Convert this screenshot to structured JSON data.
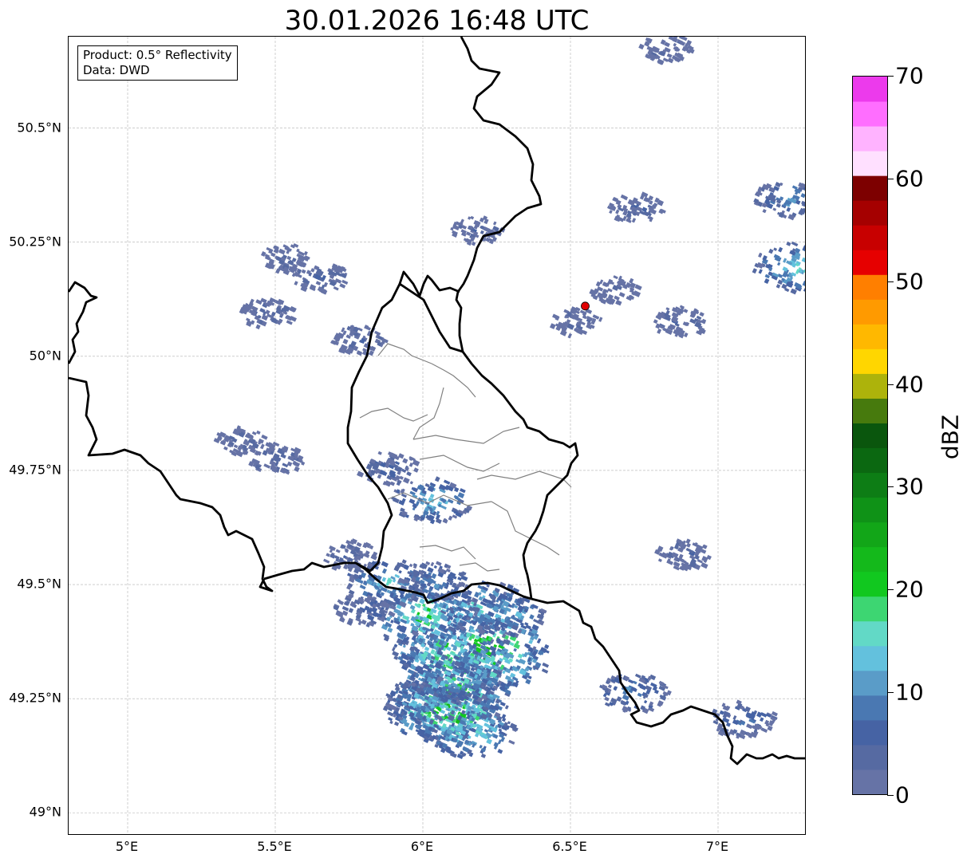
{
  "title": "30.01.2026 16:48 UTC",
  "info": {
    "product": "Product: 0.5° Reflectivity",
    "data": "Data: DWD"
  },
  "axes": {
    "lon_range": [
      4.8,
      7.3
    ],
    "lat_range": [
      48.95,
      50.7
    ],
    "x_ticks": [
      {
        "value": 5.0,
        "label": "5°E"
      },
      {
        "value": 5.5,
        "label": "5.5°E"
      },
      {
        "value": 6.0,
        "label": "6°E"
      },
      {
        "value": 6.5,
        "label": "6.5°E"
      },
      {
        "value": 7.0,
        "label": "7°E"
      }
    ],
    "y_ticks": [
      {
        "value": 49.0,
        "label": "49°N"
      },
      {
        "value": 49.25,
        "label": "49.25°N"
      },
      {
        "value": 49.5,
        "label": "49.5°N"
      },
      {
        "value": 49.75,
        "label": "49.75°N"
      },
      {
        "value": 50.0,
        "label": "50°N"
      },
      {
        "value": 50.25,
        "label": "50.25°N"
      },
      {
        "value": 50.5,
        "label": "50.5°N"
      }
    ],
    "grid": true
  },
  "radar_site": {
    "lon": 6.55,
    "lat": 50.11,
    "color": "#e00000"
  },
  "colorbar": {
    "label": "dBZ",
    "min": 0,
    "max": 70,
    "ticks": [
      {
        "value": 0,
        "label": "0"
      },
      {
        "value": 10,
        "label": "10"
      },
      {
        "value": 20,
        "label": "20"
      },
      {
        "value": 30,
        "label": "30"
      },
      {
        "value": 40,
        "label": "40"
      },
      {
        "value": 50,
        "label": "50"
      },
      {
        "value": 60,
        "label": "60"
      },
      {
        "value": 70,
        "label": "70"
      }
    ],
    "colors": [
      "#6673a6",
      "#566aa2",
      "#4663a4",
      "#4a78b2",
      "#5a9cc8",
      "#63c1dd",
      "#62d9c6",
      "#3dd672",
      "#11c81f",
      "#14b91b",
      "#12a618",
      "#0f9217",
      "#0d7d15",
      "#0b6811",
      "#0a560d",
      "#477a0d",
      "#adb30b",
      "#ffd600",
      "#ffb800",
      "#ff9a00",
      "#ff7f00",
      "#e60000",
      "#c80000",
      "#a50000",
      "#7d0000",
      "#ffe0ff",
      "#ffb3ff",
      "#ff6eff",
      "#ec3aec"
    ]
  },
  "chart_data": {
    "type": "map",
    "title": "30.01.2026 16:48 UTC",
    "xlim": [
      4.8,
      7.3
    ],
    "ylim": [
      48.95,
      50.7
    ],
    "units": "dBZ",
    "cells": [
      {
        "lon": 6.07,
        "lat": 49.24,
        "dbz": 25
      },
      {
        "lon": 6.1,
        "lat": 49.27,
        "dbz": 25
      },
      {
        "lon": 6.05,
        "lat": 49.22,
        "dbz": 22
      },
      {
        "lon": 6.13,
        "lat": 49.21,
        "dbz": 22
      },
      {
        "lon": 6.16,
        "lat": 49.18,
        "dbz": 18
      },
      {
        "lon": 6.0,
        "lat": 49.25,
        "dbz": 15
      },
      {
        "lon": 6.09,
        "lat": 49.33,
        "dbz": 22
      },
      {
        "lon": 6.07,
        "lat": 49.36,
        "dbz": 22
      },
      {
        "lon": 6.11,
        "lat": 49.3,
        "dbz": 18
      },
      {
        "lon": 6.23,
        "lat": 49.37,
        "dbz": 25
      },
      {
        "lon": 6.25,
        "lat": 49.33,
        "dbz": 20
      },
      {
        "lon": 5.99,
        "lat": 49.43,
        "dbz": 22
      },
      {
        "lon": 6.02,
        "lat": 49.45,
        "dbz": 20
      },
      {
        "lon": 6.2,
        "lat": 49.46,
        "dbz": 18
      },
      {
        "lon": 6.27,
        "lat": 49.44,
        "dbz": 15
      },
      {
        "lon": 5.88,
        "lat": 49.51,
        "dbz": 16
      },
      {
        "lon": 6.04,
        "lat": 49.51,
        "dbz": 12
      },
      {
        "lon": 5.8,
        "lat": 49.45,
        "dbz": 8
      },
      {
        "lon": 5.75,
        "lat": 49.57,
        "dbz": 6
      },
      {
        "lon": 6.03,
        "lat": 49.69,
        "dbz": 15
      },
      {
        "lon": 5.88,
        "lat": 49.76,
        "dbz": 8
      },
      {
        "lon": 5.5,
        "lat": 49.78,
        "dbz": 7
      },
      {
        "lon": 5.38,
        "lat": 49.82,
        "dbz": 5
      },
      {
        "lon": 6.71,
        "lat": 49.27,
        "dbz": 12
      },
      {
        "lon": 7.08,
        "lat": 49.21,
        "dbz": 10
      },
      {
        "lon": 6.88,
        "lat": 49.57,
        "dbz": 6
      },
      {
        "lon": 6.72,
        "lat": 50.33,
        "dbz": 6
      },
      {
        "lon": 6.87,
        "lat": 50.08,
        "dbz": 6
      },
      {
        "lon": 7.24,
        "lat": 50.35,
        "dbz": 12
      },
      {
        "lon": 7.27,
        "lat": 50.2,
        "dbz": 18
      },
      {
        "lon": 5.65,
        "lat": 50.18,
        "dbz": 6
      },
      {
        "lon": 5.47,
        "lat": 50.1,
        "dbz": 6
      },
      {
        "lon": 5.53,
        "lat": 50.22,
        "dbz": 5
      },
      {
        "lon": 5.78,
        "lat": 50.04,
        "dbz": 6
      },
      {
        "lon": 6.18,
        "lat": 50.28,
        "dbz": 5
      },
      {
        "lon": 6.82,
        "lat": 50.68,
        "dbz": 5
      },
      {
        "lon": 6.65,
        "lat": 50.15,
        "dbz": 4
      },
      {
        "lon": 6.52,
        "lat": 50.08,
        "dbz": 5
      }
    ]
  }
}
